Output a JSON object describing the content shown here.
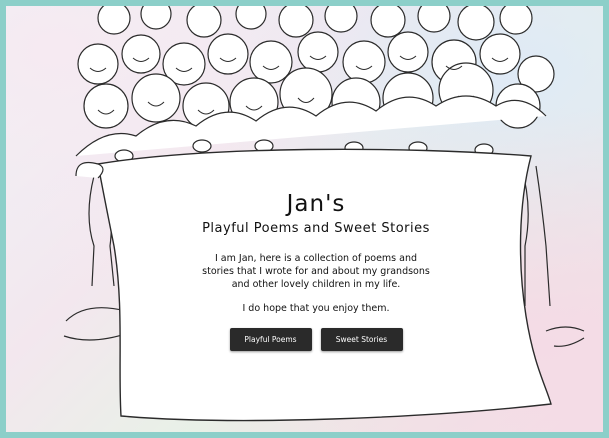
{
  "hero": {
    "title": "Jan's",
    "subtitle": "Playful Poems and Sweet Stories",
    "intro": "I am Jan, here is a collection of poems and stories that I wrote for and about my grandsons and other lovely children in my life.",
    "closing": "I do hope that you enjoy them."
  },
  "buttons": {
    "poems_label": "Playful Poems",
    "stories_label": "Sweet Stories"
  },
  "colors": {
    "frame": "#8ccfc9",
    "button_bg": "#2a2a2a",
    "button_text": "#ffffff"
  }
}
